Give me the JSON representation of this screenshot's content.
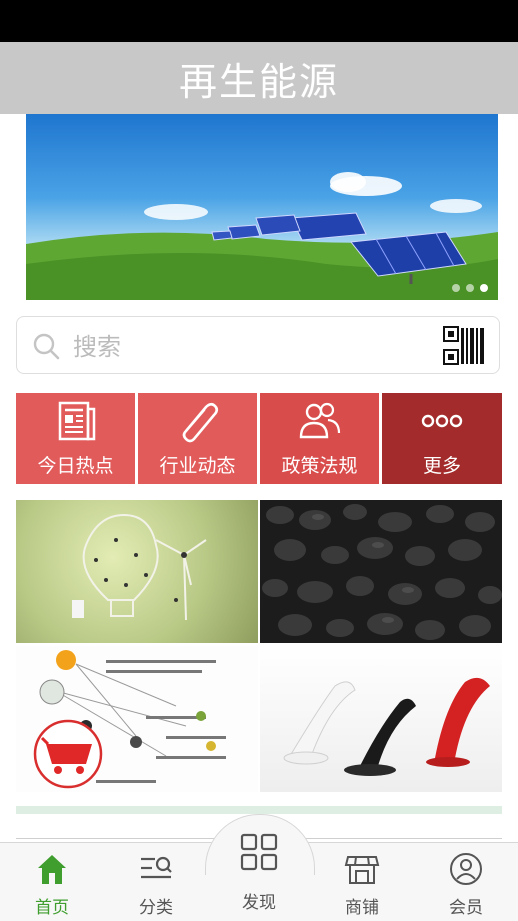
{
  "app": {
    "title": "再生能源"
  },
  "banner": {
    "alt": "solar-panels-on-green-hill",
    "slides": 3,
    "active_slide": 3
  },
  "search": {
    "placeholder": "搜索",
    "value": ""
  },
  "nav": {
    "items": [
      {
        "label": "今日热点",
        "icon": "newspaper-icon",
        "color": "#e05a5a"
      },
      {
        "label": "行业动态",
        "icon": "paperclip-icon",
        "color": "#e05a5a"
      },
      {
        "label": "政策法规",
        "icon": "people-icon",
        "color": "#d84b4b"
      },
      {
        "label": "更多",
        "icon": "more-dots-icon",
        "color": "#a32c2c"
      }
    ]
  },
  "tabbar": {
    "items": [
      {
        "label": "首页",
        "icon": "home-icon",
        "active": true
      },
      {
        "label": "分类",
        "icon": "category-icon",
        "active": false
      },
      {
        "label": "发现",
        "icon": "grid-icon",
        "active": false
      },
      {
        "label": "商铺",
        "icon": "shop-icon",
        "active": false
      },
      {
        "label": "会员",
        "icon": "user-icon",
        "active": false
      }
    ],
    "active_color": "#3f9e2e"
  }
}
